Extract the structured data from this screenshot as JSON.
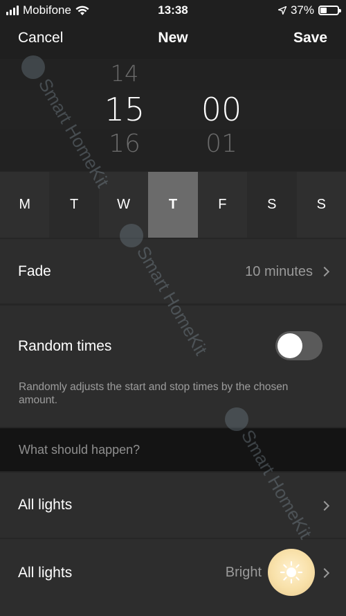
{
  "status_bar": {
    "carrier": "Mobifone",
    "time": "13:38",
    "battery_level": "37%",
    "battery_fraction": 0.37
  },
  "nav": {
    "cancel": "Cancel",
    "title": "New",
    "save": "Save"
  },
  "time_picker": {
    "hour_prev": "14",
    "hour": "15",
    "hour_next": "16",
    "minute": "00",
    "minute_next": "01"
  },
  "days": [
    {
      "label": "M",
      "active": false
    },
    {
      "label": "T",
      "active": false
    },
    {
      "label": "W",
      "active": false
    },
    {
      "label": "T",
      "active": true
    },
    {
      "label": "F",
      "active": false
    },
    {
      "label": "S",
      "active": false
    },
    {
      "label": "S",
      "active": false
    }
  ],
  "fade": {
    "label": "Fade",
    "value": "10 minutes"
  },
  "random_times": {
    "label": "Random times",
    "enabled": false,
    "description": "Randomly adjusts the start and stop times by the chosen amount."
  },
  "section": {
    "label": "What should happen?"
  },
  "lights": [
    {
      "label": "All lights",
      "value": ""
    },
    {
      "label": "All lights",
      "value": "Bright"
    }
  ],
  "watermark": "Smart HomeKit",
  "colors": {
    "background": "#262626",
    "row": "#2d2d2d",
    "active_day": "#6b6b6b",
    "sun_button": "#f8e0a8"
  }
}
